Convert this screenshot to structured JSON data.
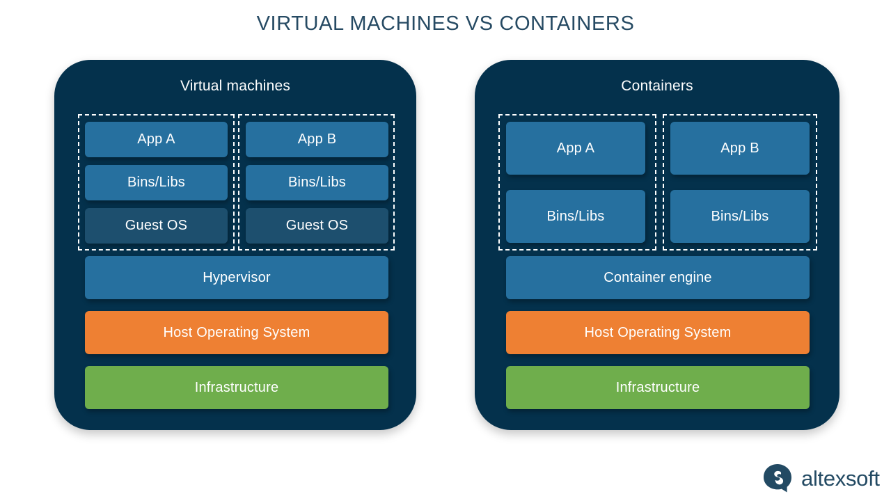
{
  "page": {
    "title": "VIRTUAL MACHINES VS CONTAINERS",
    "background_color": "#ffffff",
    "title_color": "#264a63"
  },
  "palette": {
    "panel_bg": "#04314c",
    "app_blue": "#26709f",
    "guest_os_blue": "#1d4f6e",
    "host_os_orange": "#ee8033",
    "infrastructure_green": "#6fae4c",
    "dashed_border": "#ffffff",
    "block_text": "#ffffff",
    "logo_navy": "#234a63"
  },
  "panels": [
    {
      "id": "virtual-machines",
      "title": "Virtual machines",
      "guests": [
        {
          "id": "vm-guest-a",
          "blocks": [
            {
              "label": "App A",
              "color": "app_blue"
            },
            {
              "label": "Bins/Libs",
              "color": "app_blue"
            },
            {
              "label": "Guest OS",
              "color": "guest_os_blue"
            }
          ]
        },
        {
          "id": "vm-guest-b",
          "blocks": [
            {
              "label": "App B",
              "color": "app_blue"
            },
            {
              "label": "Bins/Libs",
              "color": "app_blue"
            },
            {
              "label": "Guest OS",
              "color": "guest_os_blue"
            }
          ]
        }
      ],
      "stack": [
        {
          "label": "Hypervisor",
          "color": "app_blue"
        },
        {
          "label": "Host Operating System",
          "color": "host_os_orange"
        },
        {
          "label": "Infrastructure",
          "color": "infrastructure_green"
        }
      ]
    },
    {
      "id": "containers",
      "title": "Containers",
      "guests": [
        {
          "id": "container-a",
          "blocks": [
            {
              "label": "App A",
              "color": "app_blue"
            },
            {
              "label": "Bins/Libs",
              "color": "app_blue"
            }
          ]
        },
        {
          "id": "container-b",
          "blocks": [
            {
              "label": "App B",
              "color": "app_blue"
            },
            {
              "label": "Bins/Libs",
              "color": "app_blue"
            }
          ]
        }
      ],
      "stack": [
        {
          "label": "Container engine",
          "color": "app_blue"
        },
        {
          "label": "Host Operating System",
          "color": "host_os_orange"
        },
        {
          "label": "Infrastructure",
          "color": "infrastructure_green"
        }
      ]
    }
  ],
  "logo": {
    "brand": "altexsoft",
    "mark": "altexsoft-bubble-icon"
  }
}
